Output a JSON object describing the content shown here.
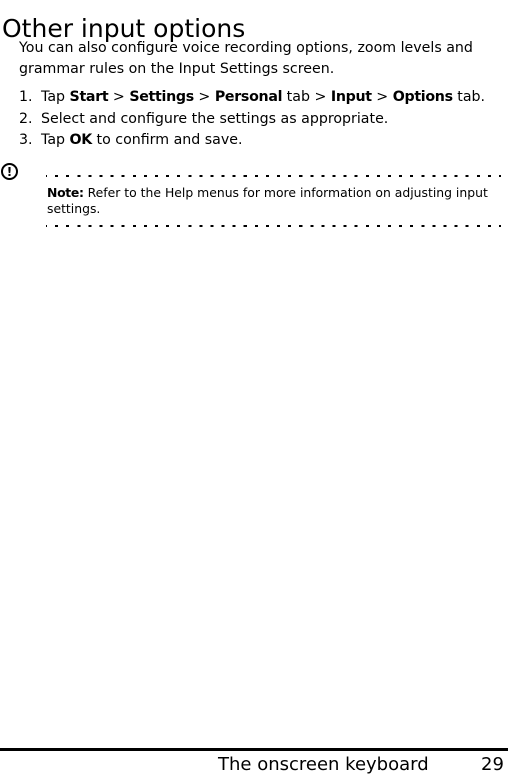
{
  "heading": "Other input options",
  "intro": "You can also configure voice recording options, zoom levels and grammar rules on the Input Settings screen.",
  "steps": [
    {
      "number": "1.",
      "parts": [
        {
          "text": "Tap ",
          "bold": false
        },
        {
          "text": "Start",
          "bold": true
        },
        {
          "text": " > ",
          "bold": false
        },
        {
          "text": "Settings",
          "bold": true
        },
        {
          "text": " > ",
          "bold": false
        },
        {
          "text": "Personal",
          "bold": true
        },
        {
          "text": " tab > ",
          "bold": false
        },
        {
          "text": "Input",
          "bold": true
        },
        {
          "text": " > ",
          "bold": false
        },
        {
          "text": "Options",
          "bold": true
        },
        {
          "text": " tab.",
          "bold": false
        }
      ]
    },
    {
      "number": "2.",
      "parts": [
        {
          "text": "Select and configure the settings as appropriate.",
          "bold": false
        }
      ]
    },
    {
      "number": "3.",
      "parts": [
        {
          "text": "Tap ",
          "bold": false
        },
        {
          "text": "OK",
          "bold": true
        },
        {
          "text": " to confirm and save.",
          "bold": false
        }
      ]
    }
  ],
  "note": {
    "icon": "exclamation-circle-icon",
    "icon_glyph": "!",
    "label": "Note:",
    "text": " Refer to the Help menus for more information on adjusting input settings."
  },
  "footer": {
    "section_title": "The onscreen keyboard",
    "page_number": "29"
  }
}
